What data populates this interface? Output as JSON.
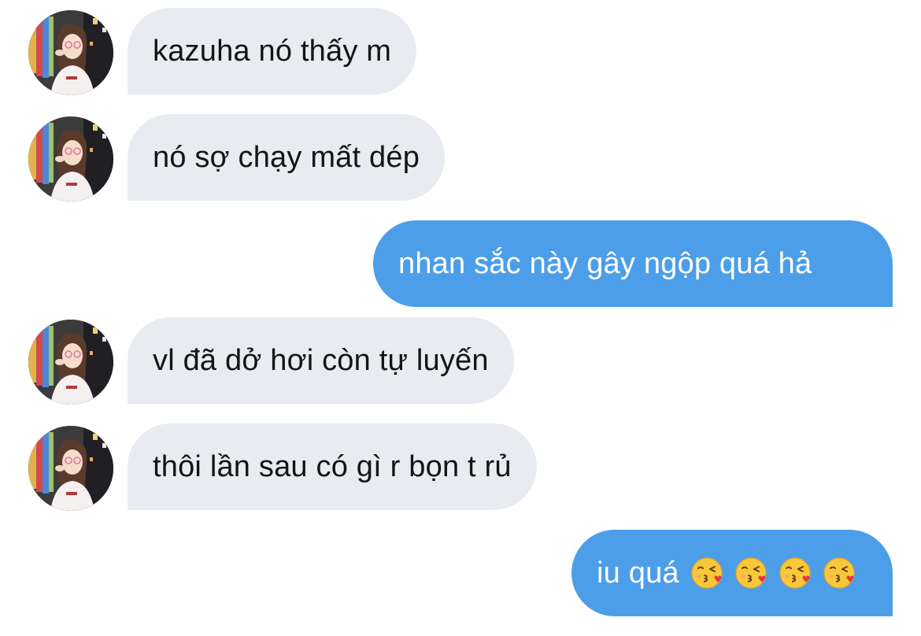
{
  "conversation": {
    "messages": [
      {
        "sender": "other",
        "text": "kazuha nó thấy m"
      },
      {
        "sender": "other",
        "text": "nó sợ chạy mất dép"
      },
      {
        "sender": "me",
        "text": "nhan sắc này gây ngộp quá hả"
      },
      {
        "sender": "other",
        "text": "vl đã dở hơi còn tự luyến"
      },
      {
        "sender": "other",
        "text": "thôi lần sau có gì r bọn t rủ"
      },
      {
        "sender": "me",
        "text": "iu quá",
        "emoji": [
          "face-blowing-a-kiss",
          "face-blowing-a-kiss",
          "face-blowing-a-kiss",
          "face-blowing-a-kiss"
        ]
      }
    ]
  },
  "colors": {
    "incoming_bubble": "#e8ebf0",
    "outgoing_bubble": "#4d9ee9",
    "incoming_text": "#141414",
    "outgoing_text": "#ffffff"
  }
}
